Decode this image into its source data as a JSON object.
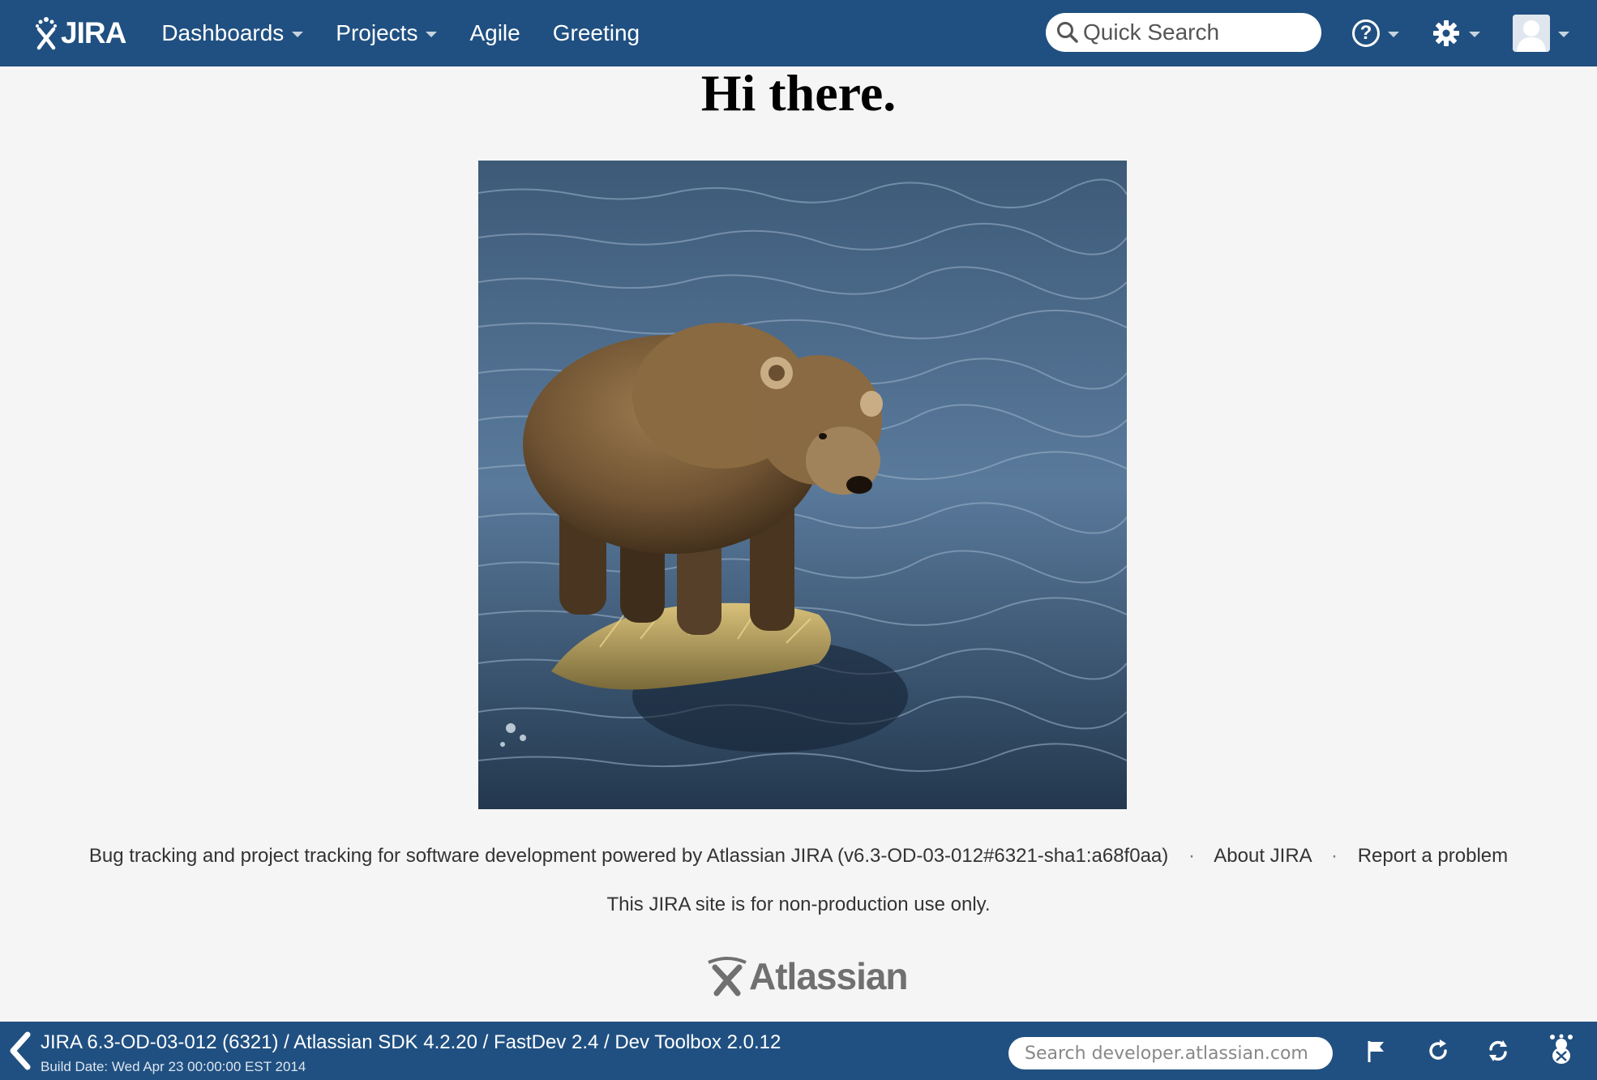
{
  "header": {
    "logo_text": "JIRA",
    "nav": [
      {
        "label": "Dashboards",
        "has_menu": true
      },
      {
        "label": "Projects",
        "has_menu": true
      },
      {
        "label": "Agile",
        "has_menu": false
      },
      {
        "label": "Greeting",
        "has_menu": false
      }
    ],
    "search": {
      "placeholder": "Quick Search"
    },
    "help_glyph": "?",
    "icons": [
      "help-icon",
      "gear-icon",
      "user-avatar-icon"
    ],
    "bg_color": "#205081"
  },
  "main": {
    "title": "Hi there.",
    "image": "brown bear standing on grass tuft in river"
  },
  "footer": {
    "powered_by": "Bug tracking and project tracking for software development powered by Atlassian JIRA (v6.3-OD-03-012#6321-sha1:a68f0aa)",
    "separator": "·",
    "about_link": "About JIRA",
    "report_link": "Report a problem",
    "note": "This JIRA site is for non-production use only.",
    "atlassian_logo_text": "Atlassian"
  },
  "devbar": {
    "title": "JIRA 6.3-OD-03-012 (6321) / Atlassian SDK 4.2.20 / FastDev 2.4 / Dev Toolbox 2.0.12",
    "build_date": "Build Date: Wed Apr 23 00:00:00 EST 2014",
    "search_placeholder": "Search developer.atlassian.com",
    "icons": [
      "back-arrow-icon",
      "flag-icon",
      "reload-icon",
      "sync-icon",
      "bug-icon"
    ]
  }
}
